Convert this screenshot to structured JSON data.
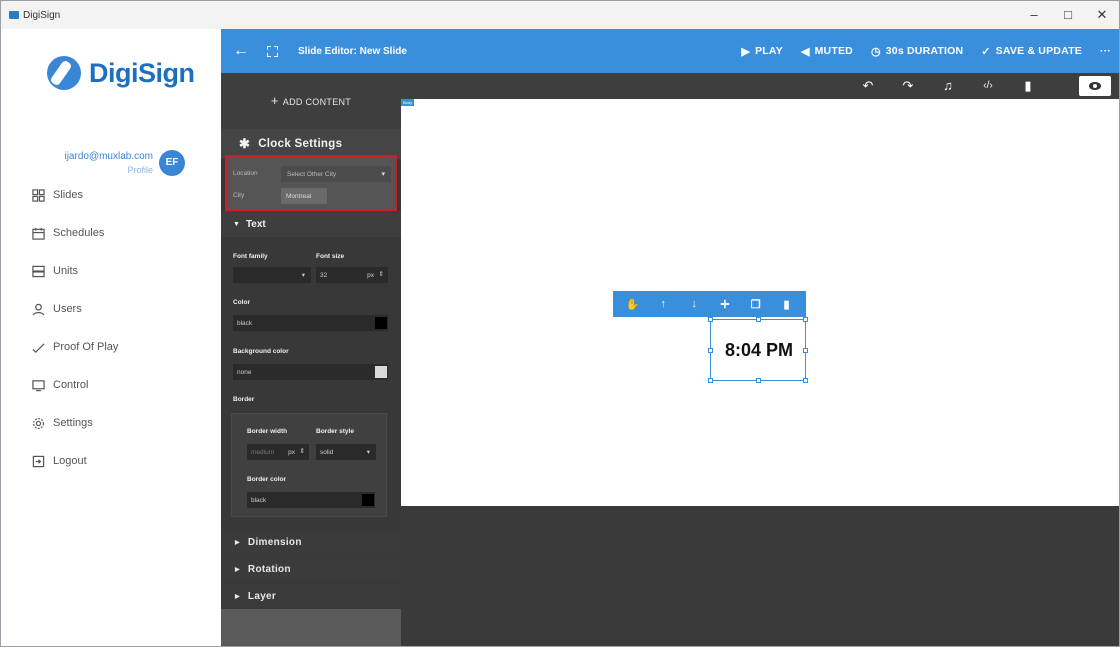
{
  "window": {
    "title": "DigiSign",
    "controls": [
      "–",
      "□",
      "✕"
    ]
  },
  "brand": {
    "name": "DigiSign",
    "color": "#1f6fc1"
  },
  "profile": {
    "email": "ijardo@muxlab.com",
    "link": "Profile",
    "initials": "EF"
  },
  "nav": {
    "items": [
      {
        "label": "Slides",
        "icon": "grid-icon"
      },
      {
        "label": "Schedules",
        "icon": "calendar-icon"
      },
      {
        "label": "Units",
        "icon": "server-icon"
      },
      {
        "label": "Users",
        "icon": "user-icon"
      },
      {
        "label": "Proof Of Play",
        "icon": "checkmark-icon"
      },
      {
        "label": "Control",
        "icon": "monitor-icon"
      },
      {
        "label": "Settings",
        "icon": "gear-icon"
      },
      {
        "label": "Logout",
        "icon": "logout-icon"
      }
    ]
  },
  "toolbar": {
    "title": "Slide Editor: New Slide",
    "play": "PLAY",
    "muted": "MUTED",
    "duration": "30s DURATION",
    "save": "SAVE & UPDATE",
    "more": "···",
    "accent": "#3a8fdc"
  },
  "panel": {
    "add_content": "ADD CONTENT",
    "section_title": "Clock Settings",
    "location": {
      "label": "Location",
      "value": "Select Other City"
    },
    "city": {
      "label": "City",
      "value": "Montreal"
    },
    "text_section": "Text",
    "font_family": {
      "label": "Font family",
      "value": ""
    },
    "font_size": {
      "label": "Font size",
      "value": "32",
      "unit": "px"
    },
    "color": {
      "label": "Color",
      "value": "black",
      "swatch": "#000000"
    },
    "background_color": {
      "label": "Background color",
      "value": "none",
      "swatch": "#d9d9d9"
    },
    "border": {
      "label": "Border",
      "width_label": "Border width",
      "width_value": "medium",
      "width_unit": "px",
      "style_label": "Border style",
      "style_value": "solid",
      "color_label": "Border color",
      "color_value": "black",
      "color_swatch": "#000000"
    },
    "folds": [
      "Dimension",
      "Rotation",
      "Layer"
    ]
  },
  "canvas": {
    "body_tag": "Body",
    "clock_text": "8:04 PM"
  }
}
